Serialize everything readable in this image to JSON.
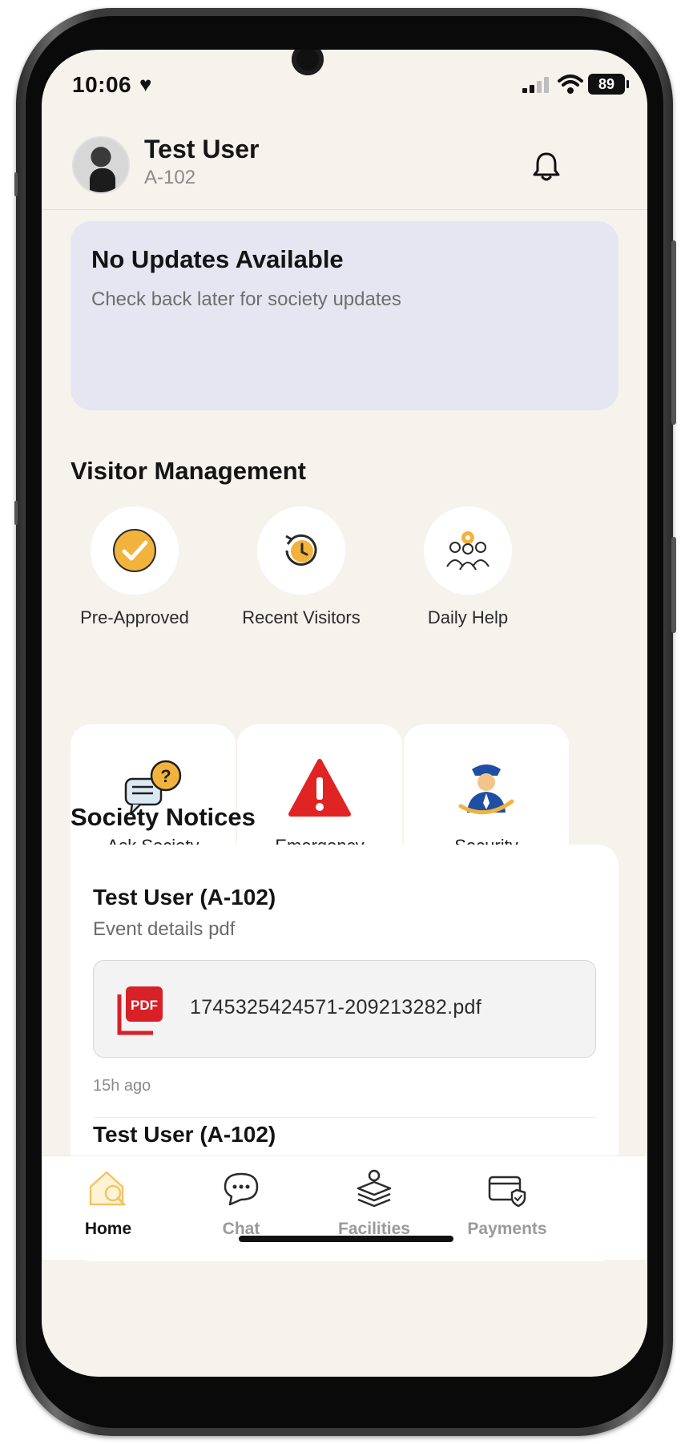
{
  "status_bar": {
    "time": "10:06",
    "heart": "♥",
    "battery": "89"
  },
  "header": {
    "user_name": "Test User",
    "unit": "A-102"
  },
  "updates": {
    "title": "No Updates Available",
    "subtitle": "Check back later for society updates"
  },
  "visitor_management": {
    "title": "Visitor Management",
    "items": [
      {
        "label": "Pre-Approved",
        "icon": "check-circle-icon"
      },
      {
        "label": "Recent Visitors",
        "icon": "history-clock-icon"
      },
      {
        "label": "Daily Help",
        "icon": "staff-group-icon"
      }
    ],
    "features": [
      {
        "label": "Ask Society",
        "icon": "question-chat-icon"
      },
      {
        "label": "Emergency",
        "icon": "warning-triangle-icon"
      },
      {
        "label": "Security",
        "icon": "security-guard-icon"
      }
    ]
  },
  "society_notices": {
    "title": "Society Notices",
    "notices": [
      {
        "author": "Test User (A-102)",
        "description": "Event details pdf",
        "attachment": {
          "file_name": "1745325424571-209213282.pdf",
          "icon_label": "PDF"
        },
        "time": "15h ago"
      },
      {
        "author": "Test User (A-102)"
      }
    ]
  },
  "bottom_nav": {
    "items": [
      {
        "label": "Home",
        "icon": "home-icon",
        "active": true
      },
      {
        "label": "Chat",
        "icon": "chat-icon",
        "active": false
      },
      {
        "label": "Facilities",
        "icon": "facilities-icon",
        "active": false
      },
      {
        "label": "Payments",
        "icon": "payment-card-icon",
        "active": false
      }
    ]
  },
  "colors": {
    "background": "#f6f3ec",
    "accent": "#f2b33d",
    "updates_card": "#e6e6f2",
    "emergency_red": "#e02424",
    "pdf_red": "#d82027"
  }
}
